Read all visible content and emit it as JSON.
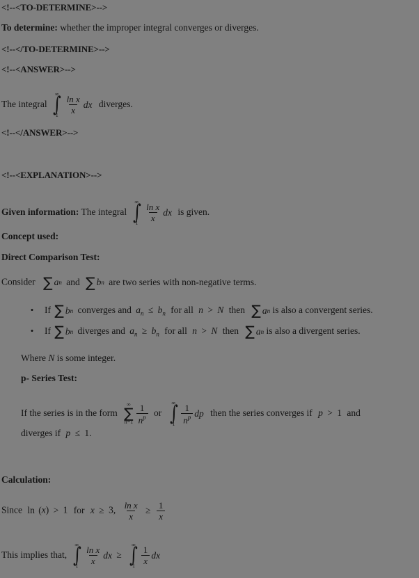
{
  "document": {
    "background_color": "#808080",
    "text_color": "#141414",
    "markers": {
      "to_determine_open": "<!--<TO-DETERMINE>-->",
      "to_determine_close": "<!--</TO-DETERMINE>-->",
      "answer_open": "<!--<ANSWER>-->",
      "answer_close": "<!--</ANSWER>-->",
      "explanation_open": "<!--<EXPLANATION>-->"
    },
    "to_determine": {
      "label": "To determine:",
      "text": "whether the improper integral converges or diverges."
    },
    "answer": {
      "prefix": "The integral",
      "integral": {
        "lower": "1",
        "upper": "∞",
        "numerator": "ln x",
        "denominator": "x",
        "differential": "dx"
      },
      "suffix": "diverges."
    },
    "given_information": {
      "label": "Given information:",
      "prefix": "The integral",
      "integral": {
        "lower": "1",
        "upper": "∞",
        "numerator": "ln x",
        "denominator": "x",
        "differential": "dx"
      },
      "suffix": "is given."
    },
    "concept_used_heading": "Concept used:",
    "direct_comparison_test": {
      "heading": "Direct Comparison Test:",
      "consider_prefix": "Consider",
      "consider_sum_a": "∑",
      "consider_a": "a",
      "consider_a_sub": "n",
      "consider_and": "and",
      "consider_sum_b": "∑",
      "consider_b": "b",
      "consider_b_sub": "n",
      "consider_suffix": "are two series with non-negative terms.",
      "bullets": [
        {
          "dot": "•",
          "if": "If",
          "sum1": "∑",
          "var1": "b",
          "var1_sub": "n",
          "verb": "converges and",
          "var2": "a",
          "var2_sub": "n",
          "relation": "≤",
          "var3": "b",
          "var3_sub": "n",
          "forall": "for all",
          "cond_n": "n",
          "cond_gt": ">",
          "cond_N": "N",
          "then": "then",
          "sum2": "∑",
          "var4": "a",
          "var4_sub": "n",
          "tail": "is also a convergent series."
        },
        {
          "dot": "•",
          "if": "If",
          "sum1": "∑",
          "var1": "b",
          "var1_sub": "n",
          "verb": "diverges and",
          "var2": "a",
          "var2_sub": "n",
          "relation": "≥",
          "var3": "b",
          "var3_sub": "n",
          "forall": "for all",
          "cond_n": "n",
          "cond_gt": ">",
          "cond_N": "N",
          "then": "then",
          "sum2": "∑",
          "var4": "a",
          "var4_sub": "n",
          "tail": "is also a divergent series."
        }
      ],
      "where_prefix": "Where",
      "where_var": "N",
      "where_suffix": "is some integer."
    },
    "p_series_test": {
      "heading": "p- Series Test:",
      "prefix": "If the series is in the form",
      "sum": {
        "glyph": "∑",
        "lower": "n=1",
        "upper": "∞",
        "numerator": "1",
        "den_base": "n",
        "den_exp": "p"
      },
      "or": "or",
      "integral": {
        "lower": "1",
        "upper": "∞",
        "numerator": "1",
        "den_base": "n",
        "den_exp": "p",
        "differential": "dp"
      },
      "middle": "then the series converges if",
      "cond_var": "p",
      "cond_op": ">",
      "cond_val": "1",
      "and": "and",
      "diverges_prefix": "diverges if",
      "div_var": "p",
      "div_op": "≤",
      "div_val": "1."
    },
    "calculation": {
      "heading": "Calculation:",
      "line1": {
        "prefix": "Since",
        "ln": "ln",
        "paren_open": "(",
        "var": "x",
        "paren_close": ")",
        "gt": ">",
        "one": "1",
        "for": "for",
        "cond_var": "x",
        "cond_rel": "≥",
        "cond_val": "3",
        "comma": ",",
        "frac1_num": "ln x",
        "frac1_den": "x",
        "rel": "≥",
        "frac2_num": "1",
        "frac2_den": "x"
      },
      "line2": {
        "prefix": "This implies that,",
        "int1": {
          "lower": "1",
          "upper": "∞",
          "numerator": "ln x",
          "denominator": "x",
          "differential": "dx"
        },
        "rel": "≥",
        "int2": {
          "lower": "1",
          "upper": "∞",
          "numerator": "1",
          "denominator": "x",
          "differential": "dx"
        }
      }
    }
  }
}
